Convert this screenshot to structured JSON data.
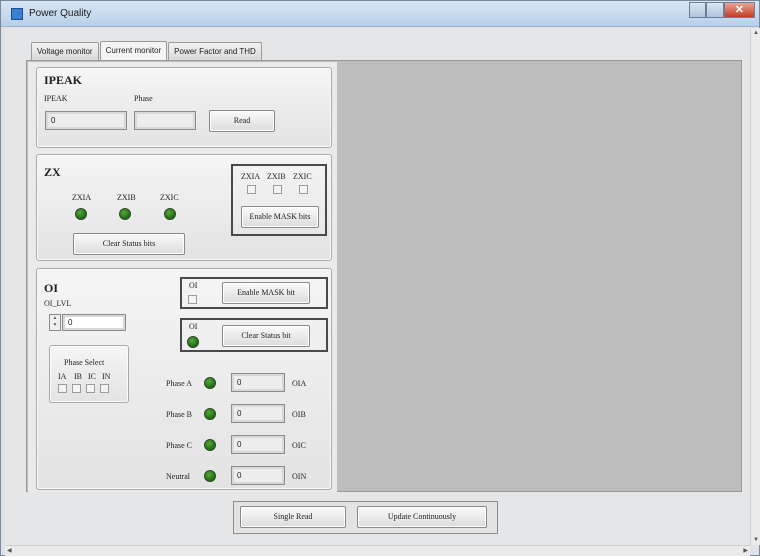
{
  "window": {
    "title": "Power Quality"
  },
  "tabs": [
    {
      "label": "Voltage monitor"
    },
    {
      "label": "Current monitor",
      "active": true
    },
    {
      "label": "Power Factor and THD"
    }
  ],
  "ipeak": {
    "title": "IPEAK",
    "ipeak_label": "IPEAK",
    "ipeak_value": "0",
    "phase_label": "Phase",
    "phase_value": "",
    "read_button": "Read"
  },
  "zx": {
    "title": "ZX",
    "leds": [
      {
        "label": "ZXIA"
      },
      {
        "label": "ZXIB"
      },
      {
        "label": "ZXIC"
      }
    ],
    "mask_labels": [
      "ZXIA",
      "ZXIB",
      "ZXIC"
    ],
    "enable_mask_button": "Enable MASK bits",
    "clear_status_button": "Clear Status bits"
  },
  "oi": {
    "title": "OI",
    "lvl_label": "OI_LVL",
    "lvl_value": "0",
    "mask_label": "OI",
    "enable_mask_button": "Enable MASK bit",
    "status_label": "OI",
    "clear_status_button": "Clear Status bit",
    "phase_select": {
      "title": "Phase Select",
      "options": [
        "IA",
        "IB",
        "IC",
        "IN"
      ]
    },
    "rows": [
      {
        "label": "Phase A",
        "value": "0",
        "unit": "OIA"
      },
      {
        "label": "Phase B",
        "value": "0",
        "unit": "OIB"
      },
      {
        "label": "Phase C",
        "value": "0",
        "unit": "OIC"
      },
      {
        "label": "Neutral",
        "value": "0",
        "unit": "OIN"
      }
    ]
  },
  "footer": {
    "single_read": "Single Read",
    "update_continuously": "Update Continuously"
  },
  "colors": {
    "led_on": "#2e8a1f",
    "panel_gray": "#bdbdbd",
    "titlebar": "#c6d9ee"
  }
}
